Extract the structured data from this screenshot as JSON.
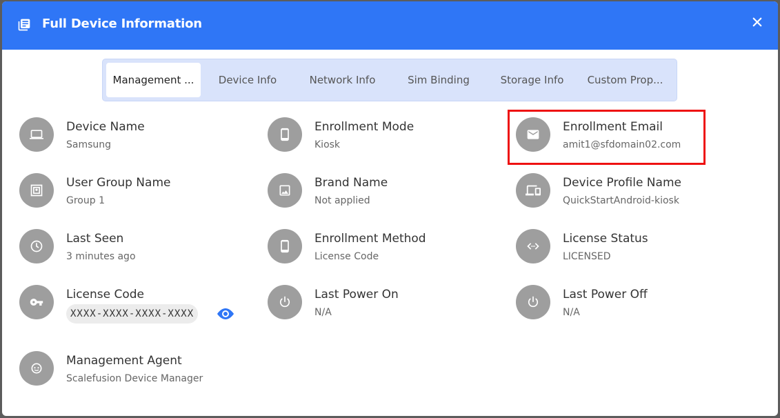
{
  "dialog": {
    "title": "Full Device Information"
  },
  "tabs": [
    {
      "label": "Management ..."
    },
    {
      "label": "Device Info"
    },
    {
      "label": "Network Info"
    },
    {
      "label": "Sim Binding"
    },
    {
      "label": "Storage Info"
    },
    {
      "label": "Custom Prop..."
    }
  ],
  "fields": {
    "device_name": {
      "label": "Device Name",
      "value": "Samsung",
      "icon": "laptop-icon"
    },
    "enrollment_mode": {
      "label": "Enrollment Mode",
      "value": "Kiosk",
      "icon": "phone-icon"
    },
    "enrollment_email": {
      "label": "Enrollment Email",
      "value": "amit1@sfdomain02.com",
      "icon": "mail-icon"
    },
    "user_group_name": {
      "label": "User Group Name",
      "value": "Group 1",
      "icon": "group-icon"
    },
    "brand_name": {
      "label": "Brand Name",
      "value": "Not applied",
      "icon": "image-icon"
    },
    "device_profile_name": {
      "label": "Device Profile Name",
      "value": "QuickStartAndroid-kiosk",
      "icon": "devices-icon"
    },
    "last_seen": {
      "label": "Last Seen",
      "value": "3 minutes ago",
      "icon": "clock-icon"
    },
    "enrollment_method": {
      "label": "Enrollment Method",
      "value": "License Code",
      "icon": "phone-icon"
    },
    "license_status": {
      "label": "License Status",
      "value": "LICENSED",
      "icon": "code-icon"
    },
    "license_code": {
      "label": "License Code",
      "value": "XXXX-XXXX-XXXX-XXXX",
      "icon": "key-icon"
    },
    "last_power_on": {
      "label": "Last Power On",
      "value": "N/A",
      "icon": "power-icon"
    },
    "last_power_off": {
      "label": "Last Power Off",
      "value": "N/A",
      "icon": "power-icon"
    },
    "management_agent": {
      "label": "Management Agent",
      "value": "Scalefusion Device Manager",
      "icon": "agent-icon"
    }
  },
  "colors": {
    "header": "#2f76f6",
    "tabs_bg": "#d9e3fb",
    "icon_circle": "#9e9e9e",
    "highlight": "#ee1111",
    "eye": "#2f76f6"
  }
}
